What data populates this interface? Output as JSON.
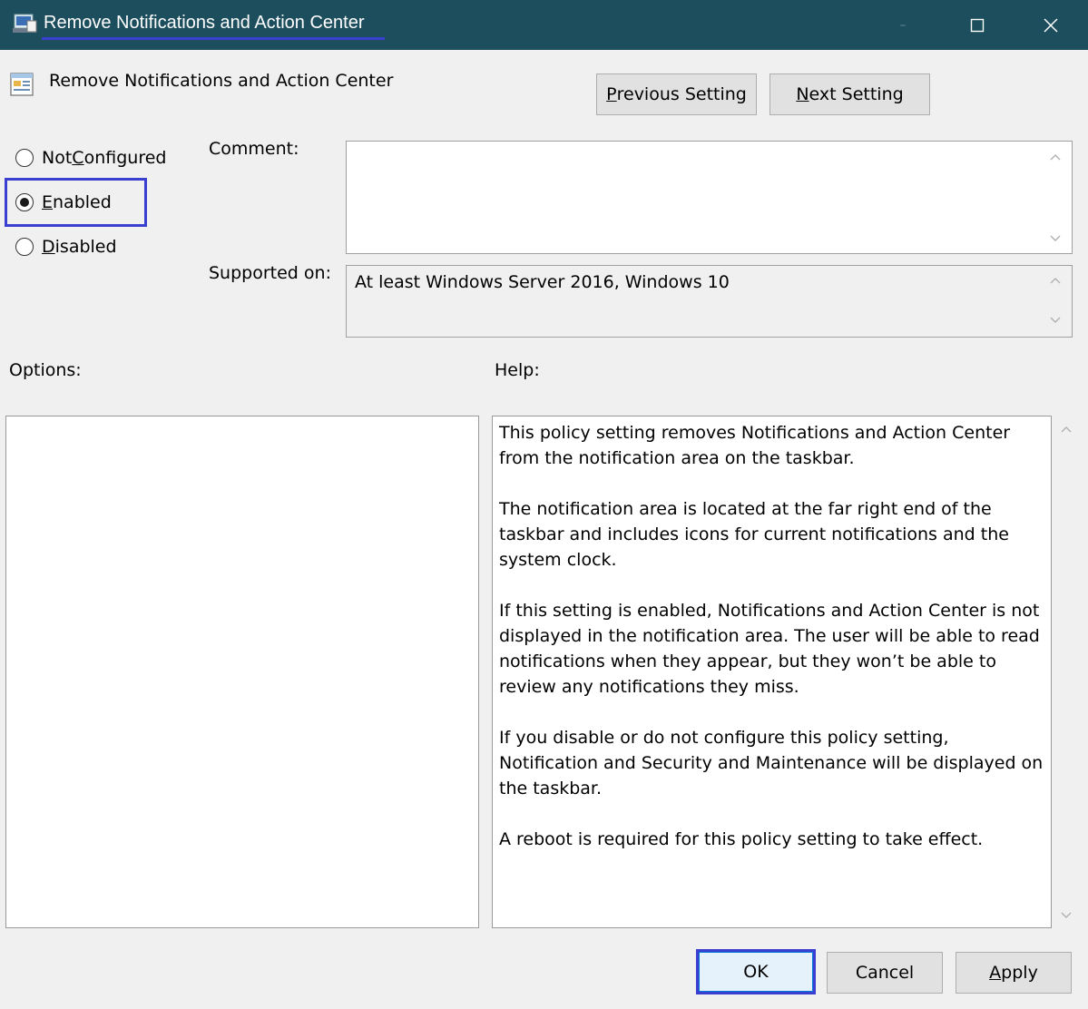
{
  "window": {
    "title": "Remove Notifications and Action Center",
    "minimize_glyph": "–",
    "close_glyph": "✕"
  },
  "header": {
    "setting_name": "Remove Notifications and Action Center",
    "previous_prefix": "P",
    "previous_rest": "revious Setting",
    "next_prefix": "N",
    "next_rest": "ext Setting"
  },
  "state": {
    "options": [
      {
        "pre": "Not ",
        "key": "C",
        "post": "onfigured",
        "selected": false
      },
      {
        "pre": "",
        "key": "E",
        "post": "nabled",
        "selected": true
      },
      {
        "pre": "",
        "key": "D",
        "post": "isabled",
        "selected": false
      }
    ]
  },
  "labels": {
    "comment": "Comment:",
    "supported_on": "Supported on:",
    "options": "Options:",
    "help": "Help:"
  },
  "comment_value": "",
  "supported_on_value": "At least Windows Server 2016, Windows 10",
  "help_text": [
    "This policy setting removes Notifications and Action Center from the notification area on the taskbar.",
    "The notification area is located at the far right end of the taskbar and includes icons for current notifications and the system clock.",
    "If this setting is enabled, Notifications and Action Center is not displayed in the notification area. The user will be able to read notifications when they appear, but they won’t be able to review any notifications they miss.",
    "If you disable or do not configure this policy setting, Notification and Security and Maintenance will be displayed on the taskbar.",
    "A reboot is required for this policy setting to take effect."
  ],
  "footer": {
    "ok": "OK",
    "cancel": "Cancel",
    "apply_prefix": "A",
    "apply_rest": "pply"
  },
  "colors": {
    "titlebar": "#1d4e5e",
    "highlight": "#3a3fd0",
    "dialog_bg": "#f0f0f0"
  }
}
